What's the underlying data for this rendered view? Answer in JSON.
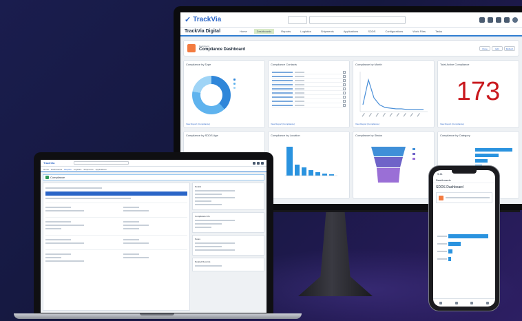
{
  "monitor": {
    "logo": "TrackVia",
    "app_name": "TrackVia Digital",
    "nav_tabs": [
      "Home",
      "Dashboards",
      "Reports",
      "Logistics",
      "Shipments",
      "Applications",
      "SDDS",
      "Configurations",
      "Work Files",
      "Tasks"
    ],
    "header": {
      "subtitle": "Dashboard",
      "title": "Compliance Dashboard"
    },
    "header_buttons": [
      "Clone",
      "Edit",
      "Refresh"
    ],
    "cards": [
      {
        "title": "Compliance by Type"
      },
      {
        "title": "Compliance Contacts"
      },
      {
        "title": "Compliance by Month"
      },
      {
        "title": "Total Active Compliance",
        "value": "173"
      },
      {
        "title": "Compliance by SDDS Age"
      },
      {
        "title": "Compliance by Location"
      },
      {
        "title": "Compliance by Status"
      },
      {
        "title": "Compliance by Category"
      }
    ],
    "footer_link": "View Report (Compliance)"
  },
  "laptop": {
    "logo": "TrackVia",
    "nav_tabs": [
      "Home",
      "Dashboards",
      "Reports",
      "Logistics",
      "Shipments",
      "Applications"
    ],
    "record_title": "Compliance",
    "side_panels": [
      "Details",
      "Compliance Info",
      "Notes",
      "Related Records"
    ]
  },
  "phone": {
    "time": "9:41",
    "back": "Dashboards",
    "title": "SDDS Dashboard"
  },
  "colors": {
    "accent": "#2a65c7",
    "big_number": "#c9191e",
    "nav_active": "#d7e9c4"
  }
}
